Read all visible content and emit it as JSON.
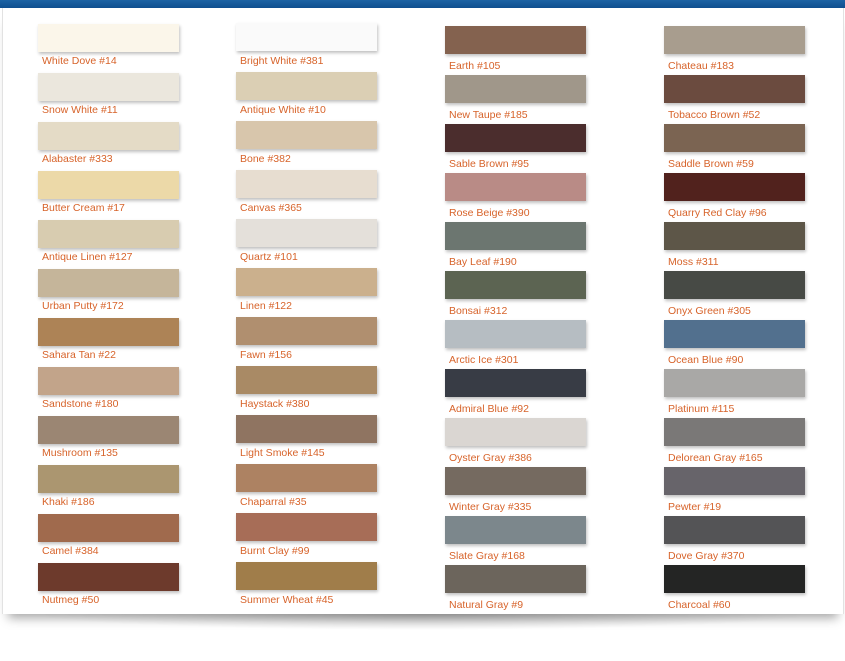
{
  "columns": [
    {
      "swatches": [
        {
          "name": "White Dove #14",
          "color": "#fbf6ea"
        },
        {
          "name": "Snow White #11",
          "color": "#ebe7dd"
        },
        {
          "name": "Alabaster #333",
          "color": "#e4dbc6"
        },
        {
          "name": "Butter Cream #17",
          "color": "#ecd9a8"
        },
        {
          "name": "Antique Linen #127",
          "color": "#d8ccb0"
        },
        {
          "name": "Urban Putty #172",
          "color": "#c5b59a"
        },
        {
          "name": "Sahara Tan #22",
          "color": "#ad8356"
        },
        {
          "name": "Sandstone #180",
          "color": "#c2a48a"
        },
        {
          "name": "Mushroom #135",
          "color": "#9b8673"
        },
        {
          "name": "Khaki #186",
          "color": "#ab9670"
        },
        {
          "name": "Camel #384",
          "color": "#a06a4d"
        },
        {
          "name": "Nutmeg #50",
          "color": "#6d3a2c"
        }
      ]
    },
    {
      "swatches": [
        {
          "name": "Bright White #381",
          "color": "#fafafa"
        },
        {
          "name": "Antique White #10",
          "color": "#dbcfb4"
        },
        {
          "name": "Bone #382",
          "color": "#d8c6ac"
        },
        {
          "name": "Canvas #365",
          "color": "#e7ddd0"
        },
        {
          "name": "Quartz #101",
          "color": "#e4e0da"
        },
        {
          "name": "Linen #122",
          "color": "#cbb08d"
        },
        {
          "name": "Fawn #156",
          "color": "#b08f6f"
        },
        {
          "name": "Haystack #380",
          "color": "#a98a65"
        },
        {
          "name": "Light Smoke #145",
          "color": "#8f7461"
        },
        {
          "name": "Chaparral #35",
          "color": "#ad8262"
        },
        {
          "name": "Burnt Clay #99",
          "color": "#a76d57"
        },
        {
          "name": "Summer Wheat #45",
          "color": "#a07d4a"
        }
      ]
    },
    {
      "swatches": [
        {
          "name": "Earth #105",
          "color": "#84624f"
        },
        {
          "name": "New Taupe #185",
          "color": "#a0978a"
        },
        {
          "name": "Sable Brown #95",
          "color": "#4b2d2d"
        },
        {
          "name": "Rose Beige #390",
          "color": "#b98b86"
        },
        {
          "name": "Bay Leaf #190",
          "color": "#6c7670"
        },
        {
          "name": "Bonsai #312",
          "color": "#5c6452"
        },
        {
          "name": "Arctic Ice #301",
          "color": "#b6bdc2"
        },
        {
          "name": "Admiral Blue #92",
          "color": "#383c45"
        },
        {
          "name": "Oyster Gray #386",
          "color": "#dad6d2"
        },
        {
          "name": "Winter Gray #335",
          "color": "#756a60"
        },
        {
          "name": "Slate Gray #168",
          "color": "#7c878c"
        },
        {
          "name": "Natural Gray #9",
          "color": "#6c655c"
        }
      ]
    },
    {
      "swatches": [
        {
          "name": "Chateau #183",
          "color": "#a89d8e"
        },
        {
          "name": "Tobacco Brown #52",
          "color": "#6b4b3f"
        },
        {
          "name": "Saddle Brown #59",
          "color": "#7b6452"
        },
        {
          "name": "Quarry Red Clay #96",
          "color": "#51221d"
        },
        {
          "name": "Moss #311",
          "color": "#5d5648"
        },
        {
          "name": "Onyx Green #305",
          "color": "#474a45"
        },
        {
          "name": "Ocean Blue #90",
          "color": "#52708e"
        },
        {
          "name": "Platinum #115",
          "color": "#a9a8a6"
        },
        {
          "name": "Delorean Gray #165",
          "color": "#7a7877"
        },
        {
          "name": "Pewter #19",
          "color": "#67646a"
        },
        {
          "name": "Dove Gray #370",
          "color": "#545456"
        },
        {
          "name": "Charcoal #60",
          "color": "#242524"
        }
      ]
    }
  ]
}
